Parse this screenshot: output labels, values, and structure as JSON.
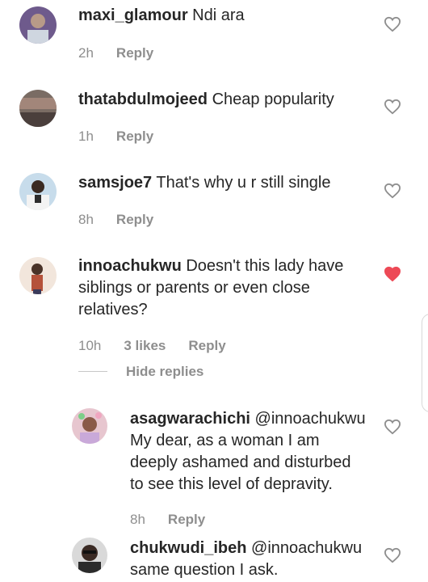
{
  "colors": {
    "liked": "#ed4956",
    "muted": "#8e8e8e",
    "text": "#262626"
  },
  "comments": [
    {
      "username": "maxi_glamour",
      "text": "Ndi ara",
      "time": "2h",
      "reply": "Reply",
      "liked": false,
      "avatar_icon": "user-avatar"
    },
    {
      "username": "thatabdulmojeed",
      "text": "Cheap popularity",
      "time": "1h",
      "reply": "Reply",
      "liked": false,
      "avatar_icon": "user-avatar"
    },
    {
      "username": "samsjoe7",
      "text": "That's why u r still single",
      "time": "8h",
      "reply": "Reply",
      "liked": false,
      "avatar_icon": "user-avatar"
    },
    {
      "username": "innoachukwu",
      "line1": "Doesn't this lady have",
      "line2": "siblings or parents or even close",
      "line3": "relatives?",
      "time": "10h",
      "likes": "3 likes",
      "reply": "Reply",
      "liked": true,
      "avatar_icon": "user-avatar"
    }
  ],
  "hide_replies": "Hide replies",
  "replies": [
    {
      "username": "asagwarachichi",
      "mention": "@innoachukwu",
      "line1": "My dear, as a woman I am",
      "line2": "deeply ashamed and disturbed",
      "line3": "to see this level of depravity.",
      "time": "8h",
      "reply": "Reply",
      "liked": false
    },
    {
      "username": "chukwudi_ibeh",
      "mention": "@innoachukwu",
      "line1": "same question I ask.",
      "liked": false
    }
  ]
}
